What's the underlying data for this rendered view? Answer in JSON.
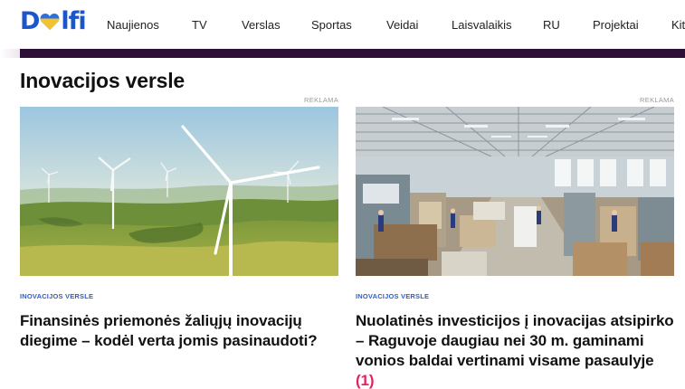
{
  "header": {
    "logo_text_left": "D",
    "logo_text_right": "lfi",
    "nav_items": [
      "Naujienos",
      "TV",
      "Verslas",
      "Sportas",
      "Veidai",
      "Laisvalaikis",
      "RU",
      "Projektai",
      "Kit"
    ]
  },
  "section": {
    "title": "Inovacijos versle"
  },
  "cards": [
    {
      "ad_label": "REKLAMA",
      "category": "INOVACIJOS VERSLE",
      "title": "Finansinės priemonės žaliųjų inovacijų diegime – kodėl verta jomis pasinaudoti?",
      "image_alt": "wind-turbines-field"
    },
    {
      "ad_label": "REKLAMA",
      "category": "INOVACIJOS VERSLE",
      "title": "Nuolatinės investicijos į inovacijas atsipirko – Raguvoje daugiau nei 30 m. gaminami vonios baldai vertinami visame pasaulyje",
      "comment_count": "(1)",
      "image_alt": "factory-floor"
    }
  ],
  "colors": {
    "brand_blue": "#1b57c9",
    "heart_blue": "#2b6fe0",
    "heart_yellow": "#f2c230",
    "strip_purple": "#2e1037",
    "category_blue": "#2f5ec7",
    "comment_red": "#e0245e"
  }
}
